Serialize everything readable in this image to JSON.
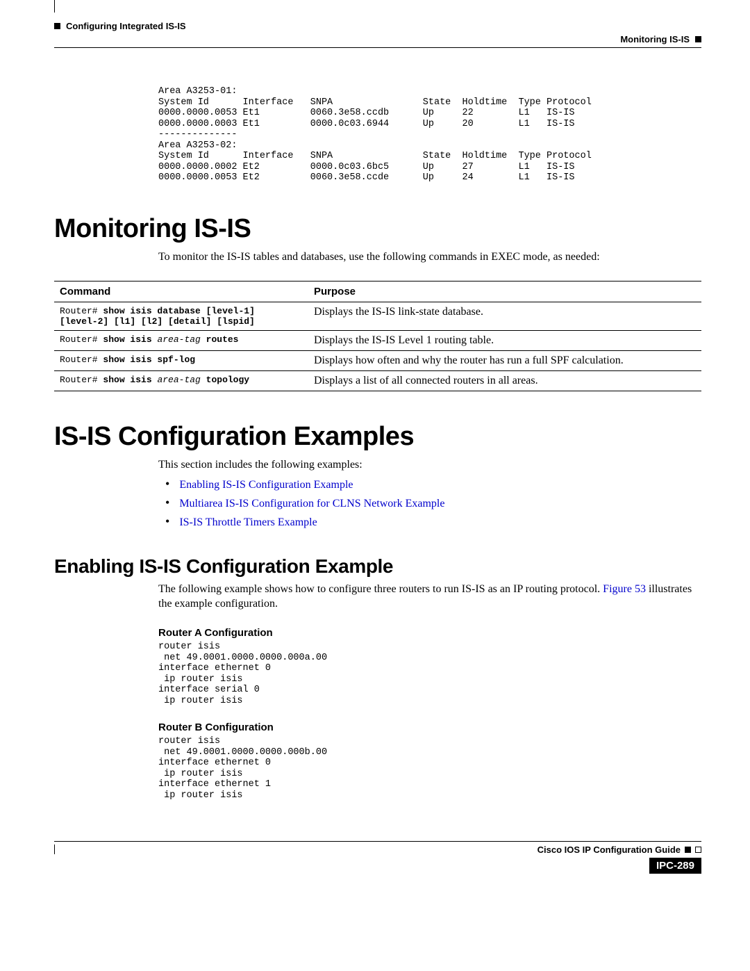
{
  "header": {
    "chapter": "Configuring Integrated IS-IS",
    "section": "Monitoring IS-IS"
  },
  "top_output": "Area A3253-01:\nSystem Id      Interface   SNPA                State  Holdtime  Type Protocol\n0000.0000.0053 Et1         0060.3e58.ccdb      Up     22        L1   IS-IS\n0000.0000.0003 Et1         0000.0c03.6944      Up     20        L1   IS-IS\n--------------\nArea A3253-02:\nSystem Id      Interface   SNPA                State  Holdtime  Type Protocol\n0000.0000.0002 Et2         0000.0c03.6bc5      Up     27        L1   IS-IS\n0000.0000.0053 Et2         0060.3e58.ccde      Up     24        L1   IS-IS",
  "h1_monitor": "Monitoring IS-IS",
  "monitor_intro": "To monitor the IS-IS tables and databases, use the following commands in EXEC mode, as needed:",
  "table": {
    "head_cmd": "Command",
    "head_purpose": "Purpose",
    "rows": [
      {
        "prompt": "Router# ",
        "kw1": "show isis database",
        "args1": " [level-1]\n[level-2] [l1] [l2] [detail] [lspid]",
        "purpose": "Displays the IS-IS link-state database."
      },
      {
        "prompt": "Router# ",
        "kw1": "show isis ",
        "ar": "area-tag",
        "kw2": " routes",
        "purpose": "Displays the IS-IS Level 1 routing table."
      },
      {
        "prompt": "Router# ",
        "kw1": "show isis spf-log",
        "purpose": "Displays how often and why the router has run a full SPF calculation."
      },
      {
        "prompt": "Router# ",
        "kw1": "show isis ",
        "ar": "area-tag",
        "kw2": " topology",
        "purpose": "Displays a list of all connected routers in all areas."
      }
    ]
  },
  "h1_examples": "IS-IS Configuration Examples",
  "examples_intro": "This section includes the following examples:",
  "examples_links": [
    "Enabling IS-IS Configuration Example",
    "Multiarea IS-IS Configuration for CLNS Network Example",
    "IS-IS Throttle Timers Example"
  ],
  "h2_enable": "Enabling IS-IS Configuration Example",
  "enable_intro_1": "The following example shows how to configure three routers to run IS-IS as an IP routing protocol. ",
  "enable_link": "Figure 53",
  "enable_intro_2": " illustrates the example configuration.",
  "router_a_head": "Router A Configuration",
  "router_a_code": "router isis\n net 49.0001.0000.0000.000a.00\ninterface ethernet 0\n ip router isis\ninterface serial 0\n ip router isis",
  "router_b_head": "Router B Configuration",
  "router_b_code": "router isis\n net 49.0001.0000.0000.000b.00\ninterface ethernet 0\n ip router isis\ninterface ethernet 1\n ip router isis",
  "footer": {
    "guide": "Cisco IOS IP Configuration Guide",
    "page": "IPC-289"
  }
}
